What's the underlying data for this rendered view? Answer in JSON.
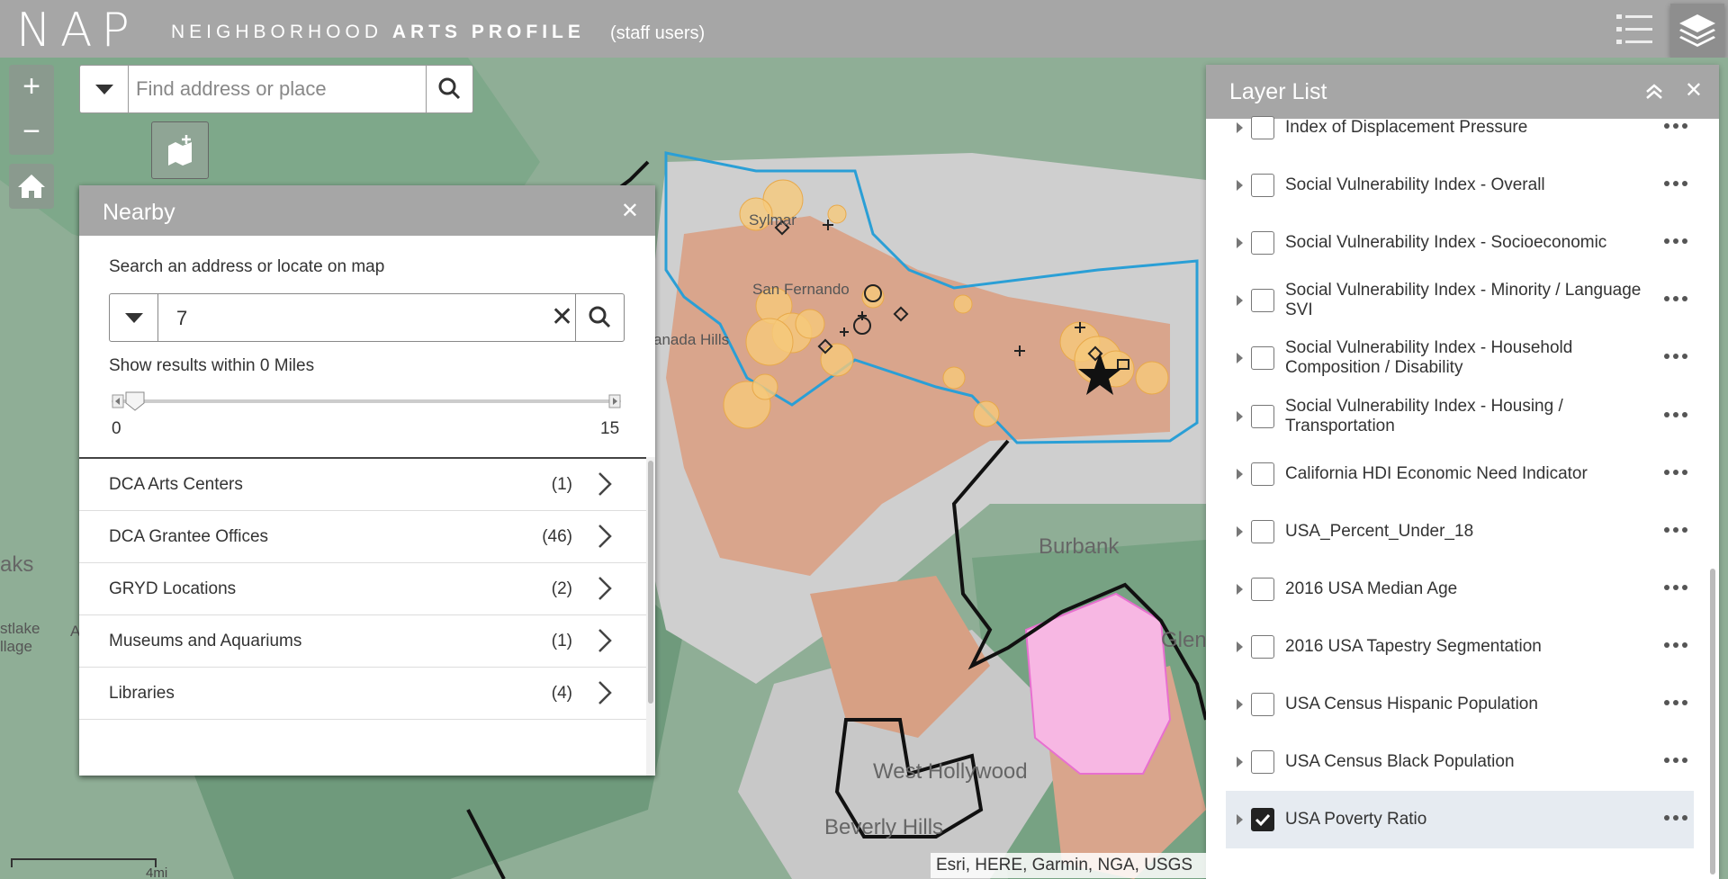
{
  "header": {
    "logo": "NAP",
    "title_prefix": "NEIGHBORHOOD",
    "title_bold": "ARTS PROFILE",
    "subtitle": "(staff users)"
  },
  "search": {
    "placeholder": "Find address or place"
  },
  "map": {
    "labels": {
      "sylmar": "Sylmar",
      "san_fernando": "San Fernando",
      "granada_hills": "anada Hills",
      "burbank": "Burbank",
      "glendale": "Glen",
      "west_hollywood": "West Hollywood",
      "beverly_hills": "Beverly Hills",
      "oaks": "aks",
      "westlake_1": "stlake",
      "westlake_2": "llage",
      "westlake_a": "A"
    },
    "scale": "4mi",
    "attribution": "Esri, HERE, Garmin, NGA, USGS",
    "colors": {
      "green": "#8fae96",
      "darkgreen": "#6f9a7c",
      "salmon": "#d9a58c",
      "grey": "#cfcfcf",
      "blue": "#2a9fd6",
      "pink": "#f7a8e0",
      "orange": "#f6c97a"
    }
  },
  "nearby": {
    "title": "Nearby",
    "hint": "Search an address or locate on map",
    "search_value": "7",
    "within": "Show results within 0 Miles",
    "slider_value": 0,
    "slider_min": "0",
    "slider_max": "15",
    "items": [
      {
        "name": "DCA Arts Centers",
        "count": "(1)"
      },
      {
        "name": "DCA Grantee Offices",
        "count": "(46)"
      },
      {
        "name": "GRYD Locations",
        "count": "(2)"
      },
      {
        "name": "Museums and Aquariums",
        "count": "(1)"
      },
      {
        "name": "Libraries",
        "count": "(4)"
      }
    ]
  },
  "layer_list": {
    "title": "Layer List",
    "items": [
      {
        "label": "Index of Displacement Pressure",
        "checked": false
      },
      {
        "label": "Social Vulnerability Index - Overall",
        "checked": false
      },
      {
        "label": "Social Vulnerability Index - Socioeconomic",
        "checked": false
      },
      {
        "label": "Social Vulnerability Index - Minority / Language SVI",
        "checked": false
      },
      {
        "label": "Social Vulnerability Index - Household Composition / Disability",
        "checked": false
      },
      {
        "label": "Social Vulnerability Index - Housing / Transportation",
        "checked": false
      },
      {
        "label": "California HDI Economic Need Indicator",
        "checked": false
      },
      {
        "label": "USA_Percent_Under_18",
        "checked": false
      },
      {
        "label": "2016 USA Median Age",
        "checked": false
      },
      {
        "label": "2016 USA Tapestry Segmentation",
        "checked": false
      },
      {
        "label": "USA Census Hispanic Population",
        "checked": false
      },
      {
        "label": "USA Census Black Population",
        "checked": false
      },
      {
        "label": "USA Poverty Ratio",
        "checked": true
      }
    ]
  }
}
